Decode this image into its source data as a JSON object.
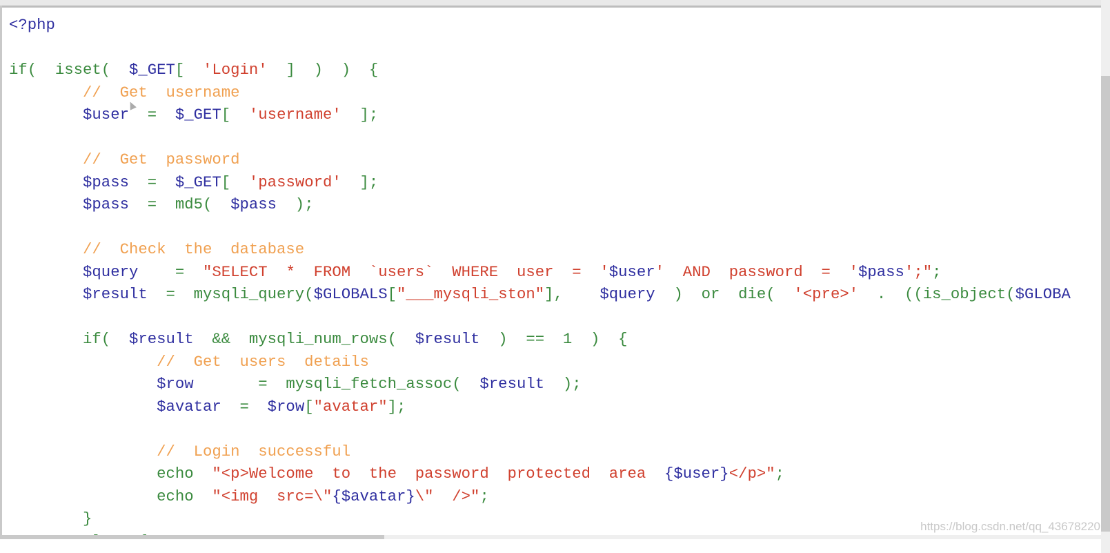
{
  "colors": {
    "keyword_green": "#3a8a3e",
    "variable_blue": "#2f2fa0",
    "string_red": "#d0402e",
    "comment_orange": "#f0a050"
  },
  "watermark": "https://blog.csdn.net/qq_43678220",
  "code_lines": [
    [
      [
        "<?php",
        "b"
      ]
    ],
    [],
    [
      [
        "if(  isset(  ",
        "g"
      ],
      [
        "$_GET",
        "b"
      ],
      [
        "[  ",
        "g"
      ],
      [
        "'Login'",
        "r"
      ],
      [
        "  ]  )  )  {",
        "g"
      ]
    ],
    [
      [
        "        //  Get  username",
        "o"
      ]
    ],
    [
      [
        "        ",
        "g"
      ],
      [
        "$user",
        "b"
      ],
      [
        "  =  ",
        "g"
      ],
      [
        "$_GET",
        "b"
      ],
      [
        "[  ",
        "g"
      ],
      [
        "'username'",
        "r"
      ],
      [
        "  ];",
        "g"
      ]
    ],
    [],
    [
      [
        "        //  Get  password",
        "o"
      ]
    ],
    [
      [
        "        ",
        "g"
      ],
      [
        "$pass",
        "b"
      ],
      [
        "  =  ",
        "g"
      ],
      [
        "$_GET",
        "b"
      ],
      [
        "[  ",
        "g"
      ],
      [
        "'password'",
        "r"
      ],
      [
        "  ];",
        "g"
      ]
    ],
    [
      [
        "        ",
        "g"
      ],
      [
        "$pass",
        "b"
      ],
      [
        "  =  md5(  ",
        "g"
      ],
      [
        "$pass",
        "b"
      ],
      [
        "  );",
        "g"
      ]
    ],
    [],
    [
      [
        "        //  Check  the  database",
        "o"
      ]
    ],
    [
      [
        "        ",
        "g"
      ],
      [
        "$query",
        "b"
      ],
      [
        "    =  ",
        "g"
      ],
      [
        "\"SELECT  *  FROM  `users`  WHERE  user  =  '",
        "r"
      ],
      [
        "$user",
        "b"
      ],
      [
        "'  AND  password  =  '",
        "r"
      ],
      [
        "$pass",
        "b"
      ],
      [
        "';\"",
        "r"
      ],
      [
        ";",
        "g"
      ]
    ],
    [
      [
        "        ",
        "g"
      ],
      [
        "$result",
        "b"
      ],
      [
        "  =  mysqli_query(",
        "g"
      ],
      [
        "$GLOBALS",
        "b"
      ],
      [
        "[",
        "g"
      ],
      [
        "\"___mysqli_ston\"",
        "r"
      ],
      [
        "],    ",
        "g"
      ],
      [
        "$query",
        "b"
      ],
      [
        "  )  or  die(  ",
        "g"
      ],
      [
        "'<pre>'",
        "r"
      ],
      [
        "  .  ((is_object(",
        "g"
      ],
      [
        "$GLOBA",
        "b"
      ]
    ],
    [],
    [
      [
        "        if(  ",
        "g"
      ],
      [
        "$result",
        "b"
      ],
      [
        "  &&  mysqli_num_rows(  ",
        "g"
      ],
      [
        "$result",
        "b"
      ],
      [
        "  )  ==  1  )  {",
        "g"
      ]
    ],
    [
      [
        "                //  Get  users  details",
        "o"
      ]
    ],
    [
      [
        "                ",
        "g"
      ],
      [
        "$row",
        "b"
      ],
      [
        "       =  mysqli_fetch_assoc(  ",
        "g"
      ],
      [
        "$result",
        "b"
      ],
      [
        "  );",
        "g"
      ]
    ],
    [
      [
        "                ",
        "g"
      ],
      [
        "$avatar",
        "b"
      ],
      [
        "  =  ",
        "g"
      ],
      [
        "$row",
        "b"
      ],
      [
        "[",
        "g"
      ],
      [
        "\"avatar\"",
        "r"
      ],
      [
        "];",
        "g"
      ]
    ],
    [],
    [
      [
        "                //  Login  successful",
        "o"
      ]
    ],
    [
      [
        "                echo  ",
        "g"
      ],
      [
        "\"<p>Welcome  to  the  password  protected  area  ",
        "r"
      ],
      [
        "{$user}",
        "b"
      ],
      [
        "</p>\"",
        "r"
      ],
      [
        ";",
        "g"
      ]
    ],
    [
      [
        "                echo  ",
        "g"
      ],
      [
        "\"<img  src=\\\"",
        "r"
      ],
      [
        "{$avatar}",
        "b"
      ],
      [
        "\\\"  />\"",
        "r"
      ],
      [
        ";",
        "g"
      ]
    ],
    [
      [
        "        }",
        "g"
      ]
    ],
    [
      [
        "        else  {",
        "g"
      ]
    ]
  ]
}
